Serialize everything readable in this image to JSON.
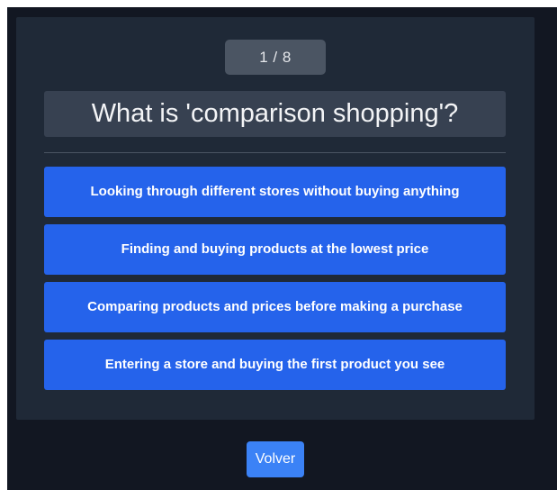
{
  "quiz": {
    "progress": "1 / 8",
    "question": "What is 'comparison shopping'?",
    "answers": [
      "Looking through different stores without buying anything",
      "Finding and buying products at the lowest price",
      "Comparing products and prices before making a purchase",
      "Entering a store and buying the first product you see"
    ]
  },
  "footer": {
    "back_label": "Volver"
  },
  "colors": {
    "page_background": "#121722",
    "card_background": "#1f2937",
    "answer_button": "#2563eb",
    "back_button": "#3b82f6"
  }
}
